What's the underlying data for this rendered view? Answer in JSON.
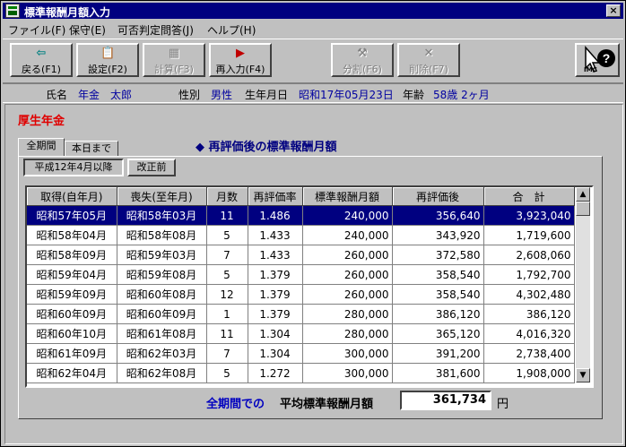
{
  "window": {
    "title": "標準報酬月額入力",
    "close": "×"
  },
  "menu": [
    "ファイル(F)",
    "保守(E)",
    "可否判定問答(J)",
    "ヘルプ(H)"
  ],
  "toolbar": {
    "back": "戻る(F1)",
    "settings": "設定(F2)",
    "calc": "計算(F3)",
    "reenter": "再入力(F4)",
    "split": "分割(F6)",
    "delete": "削除(F7)",
    "imc": "IMC"
  },
  "person": {
    "name_label": "氏名",
    "name": "年金　太郎",
    "sex_label": "性別",
    "sex": "男性",
    "birth_label": "生年月日",
    "birth": "昭和17年05月23日",
    "age_label": "年齢",
    "age": "58歳 2ヶ月"
  },
  "section_title": "厚生年金",
  "tabs": [
    "全期間",
    "本日まで"
  ],
  "heading": "再評価後の標準報酬月額",
  "subbuttons": [
    "平成12年4月以降",
    "改正前"
  ],
  "table": {
    "columns": [
      "取得(自年月)",
      "喪失(至年月)",
      "月数",
      "再評価率",
      "標準報酬月額",
      "再評価後",
      "合　計"
    ],
    "rows": [
      [
        "昭和57年05月",
        "昭和58年03月",
        "11",
        "1.486",
        "240,000",
        "356,640",
        "3,923,040"
      ],
      [
        "昭和58年04月",
        "昭和58年08月",
        "5",
        "1.433",
        "240,000",
        "343,920",
        "1,719,600"
      ],
      [
        "昭和58年09月",
        "昭和59年03月",
        "7",
        "1.433",
        "260,000",
        "372,580",
        "2,608,060"
      ],
      [
        "昭和59年04月",
        "昭和59年08月",
        "5",
        "1.379",
        "260,000",
        "358,540",
        "1,792,700"
      ],
      [
        "昭和59年09月",
        "昭和60年08月",
        "12",
        "1.379",
        "260,000",
        "358,540",
        "4,302,480"
      ],
      [
        "昭和60年09月",
        "昭和60年09月",
        "1",
        "1.379",
        "280,000",
        "386,120",
        "386,120"
      ],
      [
        "昭和60年10月",
        "昭和61年08月",
        "11",
        "1.304",
        "280,000",
        "365,120",
        "4,016,320"
      ],
      [
        "昭和61年09月",
        "昭和62年03月",
        "7",
        "1.304",
        "300,000",
        "391,200",
        "2,738,400"
      ],
      [
        "昭和62年04月",
        "昭和62年08月",
        "5",
        "1.272",
        "300,000",
        "381,600",
        "1,908,000"
      ]
    ]
  },
  "average": {
    "label_blue": "全期間での",
    "label": "平均標準報酬月額",
    "value": "361,734",
    "unit": "円"
  },
  "colors": {
    "accent": "#000080",
    "section": "#e00000",
    "label_blue": "#0000a0"
  }
}
